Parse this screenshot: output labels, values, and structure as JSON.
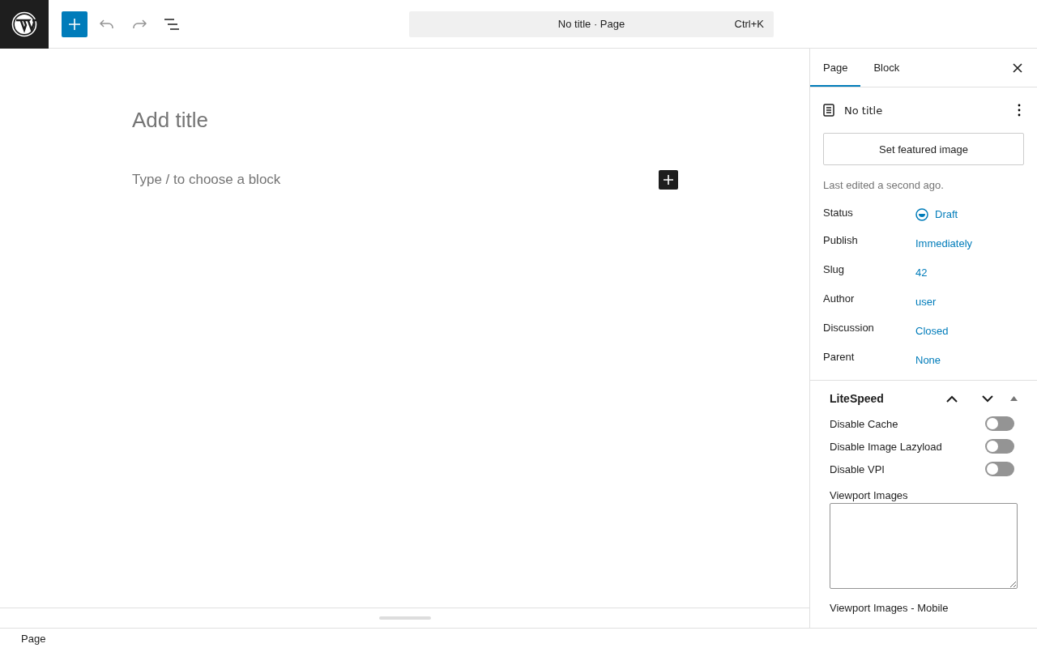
{
  "toolbar": {
    "document_title": "No title · Page",
    "shortcut": "Ctrl+K"
  },
  "editor": {
    "title_placeholder": "Add title",
    "block_placeholder": "Type / to choose a block"
  },
  "sidebar": {
    "tabs": [
      {
        "label": "Page",
        "selected": true
      },
      {
        "label": "Block",
        "selected": false
      }
    ],
    "post_title": "No title",
    "featured_image_button": "Set featured image",
    "last_edited": "Last edited a second ago.",
    "fields": [
      {
        "label": "Status",
        "value": "Draft",
        "kind": "status"
      },
      {
        "label": "Publish",
        "value": "Immediately",
        "kind": "link"
      },
      {
        "label": "Slug",
        "value": "42",
        "kind": "link"
      },
      {
        "label": "Author",
        "value": "user",
        "kind": "link"
      },
      {
        "label": "Discussion",
        "value": "Closed",
        "kind": "link"
      },
      {
        "label": "Parent",
        "value": "None",
        "kind": "link"
      }
    ],
    "panels": [
      {
        "title": "LiteSpeed",
        "expanded": true,
        "toggles": [
          {
            "label": "Disable Cache",
            "on": false
          },
          {
            "label": "Disable Image Lazyload",
            "on": false
          },
          {
            "label": "Disable VPI",
            "on": false
          }
        ],
        "textareas": [
          {
            "label": "Viewport Images"
          },
          {
            "label": "Viewport Images - Mobile"
          }
        ]
      }
    ]
  },
  "footer": {
    "breadcrumb": "Page"
  }
}
